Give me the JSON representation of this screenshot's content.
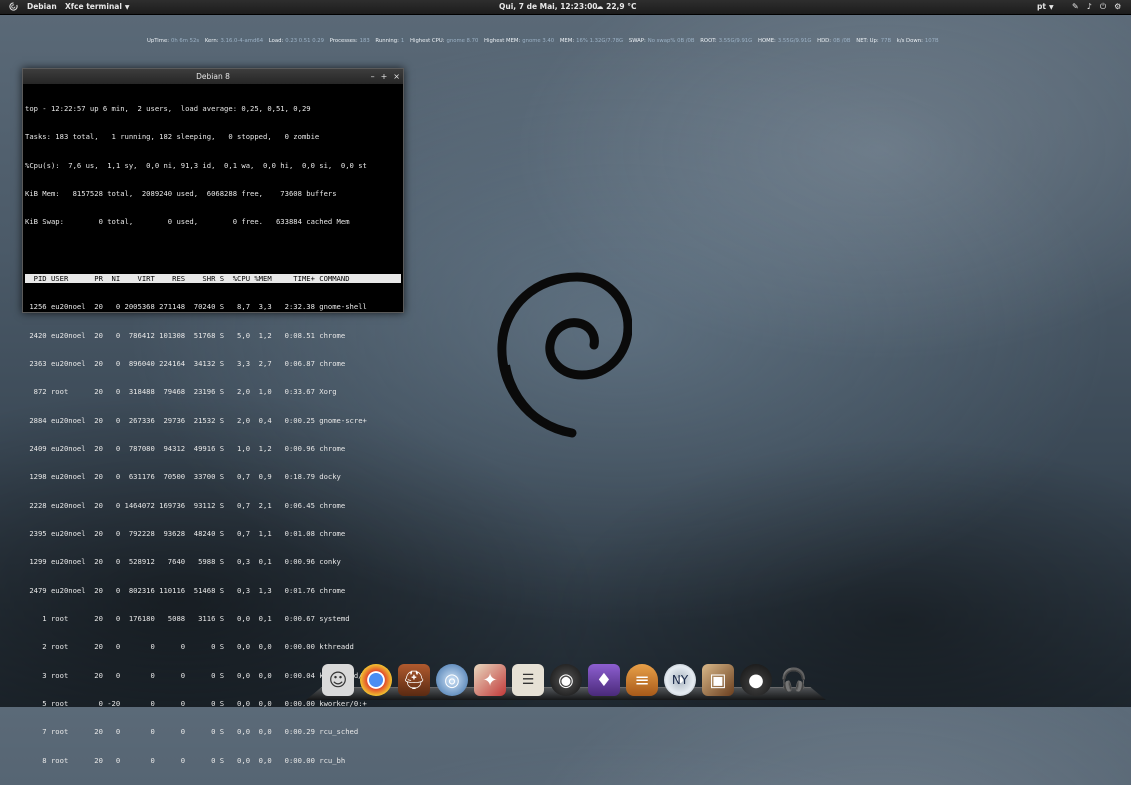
{
  "panel": {
    "app_name": "Debian",
    "menu_label": "Xfce terminal",
    "clock": "Qui, 7 de Mai, 12:23:00",
    "weather": "22,9 °C",
    "language": "pt",
    "tray_icons": [
      "pencil-icon",
      "speaker-icon",
      "power-icon",
      "gear-icon"
    ]
  },
  "conky": {
    "uptime_label": "UpTime:",
    "uptime": "0h 6m 52s",
    "kern_label": "Kern:",
    "kern": "3.16.0-4-amd64",
    "load_label": "Load:",
    "load": "0.23 0.51 0.29",
    "processes_label": "Processes:",
    "processes": "183",
    "running_label": "Running:",
    "running": "1",
    "highest_cpu_label": "Highest CPU:",
    "highest_cpu": "gnome 8.70",
    "highest_mem_label": "Highest MEM:",
    "highest_mem": "gnome 3.40",
    "mem_label": "MEM:",
    "mem": "16% 1.32G/7.78G",
    "swap_label": "SWAP:",
    "swap": "No swap% 0B /0B",
    "root_label": "ROOT:",
    "root": "3.55G/9.91G",
    "home_label": "HOME:",
    "home": "3.55G/9.91G",
    "hdd_label": "HDD:",
    "hdd": "0B /0B",
    "net_label": "NET: Up:",
    "net_up": "77B",
    "down_label": "k/s  Down:",
    "net_down": "107B"
  },
  "terminal": {
    "title": "Debian 8",
    "buttons": [
      "–",
      "+",
      "×"
    ],
    "summary": [
      "top - 12:22:57 up 6 min,  2 users,  load average: 0,25, 0,51, 0,29",
      "Tasks: 183 total,   1 running, 182 sleeping,   0 stopped,   0 zombie",
      "%Cpu(s):  7,6 us,  1,1 sy,  0,0 ni, 91,3 id,  0,1 wa,  0,0 hi,  0,0 si,  0,0 st",
      "KiB Mem:   8157528 total,  2089240 used,  6068288 free,    73608 buffers",
      "KiB Swap:        0 total,        0 used,        0 free.   633884 cached Mem"
    ],
    "table_header": "  PID USER      PR  NI    VIRT    RES    SHR S  %CPU %MEM     TIME+ COMMAND",
    "rows": [
      " 1256 eu20noel  20   0 2005368 271148  70240 S   8,7  3,3   2:32.38 gnome-shell",
      " 2420 eu20noel  20   0  786412 101308  51768 S   5,0  1,2   0:08.51 chrome",
      " 2363 eu20noel  20   0  896040 224164  34132 S   3,3  2,7   0:06.87 chrome",
      "  872 root      20   0  318488  79468  23196 S   2,0  1,0   0:33.67 Xorg",
      " 2884 eu20noel  20   0  267336  29736  21532 S   2,0  0,4   0:00.25 gnome-scre+",
      " 2409 eu20noel  20   0  787080  94312  49916 S   1,0  1,2   0:00.96 chrome",
      " 1298 eu20noel  20   0  631176  70500  33700 S   0,7  0,9   0:18.79 docky",
      " 2228 eu20noel  20   0 1464072 169736  93112 S   0,7  2,1   0:06.45 chrome",
      " 2395 eu20noel  20   0  792228  93628  48240 S   0,7  1,1   0:01.08 chrome",
      " 1299 eu20noel  20   0  528912   7640   5988 S   0,3  0,1   0:00.96 conky",
      " 2479 eu20noel  20   0  802316 110116  51468 S   0,3  1,3   0:01.76 chrome",
      "    1 root      20   0  176180   5088   3116 S   0,0  0,1   0:00.67 systemd",
      "    2 root      20   0       0      0      0 S   0,0  0,0   0:00.00 kthreadd",
      "    3 root      20   0       0      0      0 S   0,0  0,0   0:00.04 ksoftirqd/0",
      "    5 root       0 -20       0      0      0 S   0,0  0,0   0:00.00 kworker/0:+",
      "    7 root      20   0       0      0      0 S   0,0  0,0   0:00.29 rcu_sched",
      "    8 root      20   0       0      0      0 S   0,0  0,0   0:00.00 rcu_bh"
    ]
  },
  "dock": {
    "items": [
      {
        "name": "finder-icon",
        "color": "#d9d9d9"
      },
      {
        "name": "chrome-icon",
        "color": "#e24b2c"
      },
      {
        "name": "halo-helmet-icon",
        "color": "#8a3b1e"
      },
      {
        "name": "disk-utility-icon",
        "color": "#3a6ea8"
      },
      {
        "name": "photos-icon",
        "color": "#c23a3a"
      },
      {
        "name": "news-reader-icon",
        "color": "#e6e1d5"
      },
      {
        "name": "camera-icon",
        "color": "#2b2b2b"
      },
      {
        "name": "steam-game-icon",
        "color": "#6a3fa0"
      },
      {
        "name": "burger-icon",
        "color": "#d98a2e"
      },
      {
        "name": "yankees-disc-icon",
        "color": "#b8c2cc"
      },
      {
        "name": "photo-stack-icon",
        "color": "#9c6b3a"
      },
      {
        "name": "penguin-bomb-icon",
        "color": "#222222"
      },
      {
        "name": "headphones-icon",
        "color": "#1a1a1a"
      }
    ]
  }
}
